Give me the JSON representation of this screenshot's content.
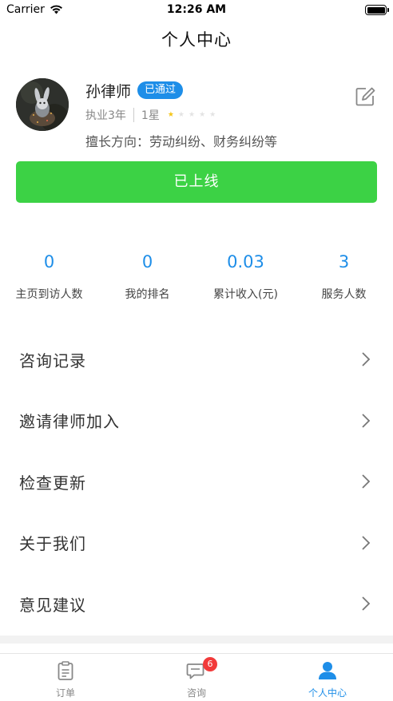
{
  "status_bar": {
    "carrier": "Carrier",
    "time": "12:26 AM"
  },
  "nav": {
    "title": "个人中心"
  },
  "profile": {
    "name": "孙律师",
    "status_badge": "已通过",
    "experience": "执业3年",
    "rating_label": "1星",
    "rating": 1,
    "rating_max": 5,
    "specialty": "擅长方向：劳动纠纷、财务纠纷等",
    "edit_icon": "edit-icon"
  },
  "online_button": {
    "label": "已上线"
  },
  "stats": [
    {
      "value": "0",
      "label": "主页到访人数"
    },
    {
      "value": "0",
      "label": "我的排名"
    },
    {
      "value": "0.03",
      "label": "累计收入(元)"
    },
    {
      "value": "3",
      "label": "服务人数"
    }
  ],
  "menu": [
    {
      "label": "咨询记录"
    },
    {
      "label": "邀请律师加入"
    },
    {
      "label": "检查更新"
    },
    {
      "label": "关于我们"
    },
    {
      "label": "意见建议"
    }
  ],
  "tabbar": {
    "tabs": [
      {
        "label": "订单",
        "icon": "clipboard-icon"
      },
      {
        "label": "咨询",
        "icon": "chat-icon",
        "badge": "6"
      },
      {
        "label": "个人中心",
        "icon": "person-icon",
        "active": true
      }
    ]
  },
  "colors": {
    "accent_blue": "#1e8ee8",
    "online_green": "#3cd245",
    "badge_red": "#f23a3a",
    "star_gold": "#f5c518"
  }
}
